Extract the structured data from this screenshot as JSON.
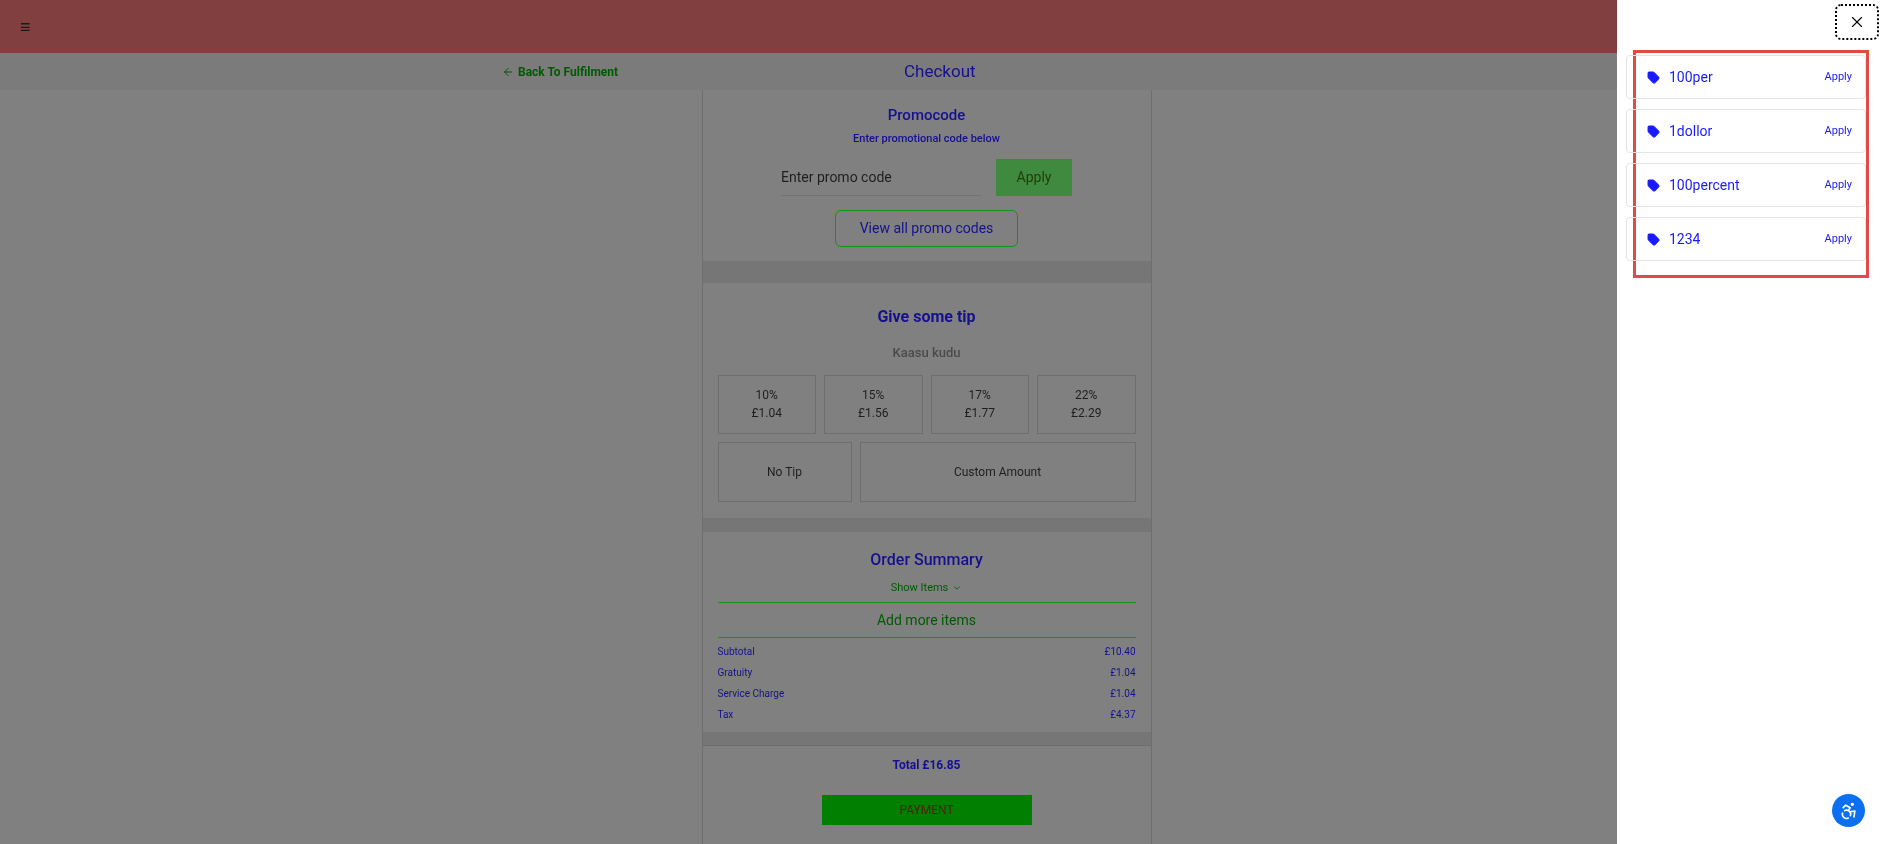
{
  "header": {
    "menu": "≡"
  },
  "subheader": {
    "back_link": "Back To Fulfilment",
    "title": "Checkout"
  },
  "promocode": {
    "title": "Promocode",
    "subtitle": "Enter promotional code below",
    "input": {
      "placeholder": "Enter promo code"
    },
    "apply": "Apply",
    "view_all": "View all promo codes"
  },
  "tip": {
    "title": "Give some tip",
    "subtitle": "Kaasu kudu",
    "options": [
      {
        "percent": "10%",
        "amount": "£1.04",
        "selected": false
      },
      {
        "percent": "15%",
        "amount": "£1.56",
        "selected": false
      },
      {
        "percent": "17%",
        "amount": "£1.77",
        "selected": false
      },
      {
        "percent": "22%",
        "amount": "£2.29",
        "selected": false
      }
    ],
    "others": [
      {
        "label": "No Tip",
        "selected": false
      },
      {
        "label": "Custom Amount",
        "selected": false
      }
    ]
  },
  "order_summary": {
    "title": "Order Summary",
    "show_items": "Show Items",
    "add_more": "Add more items",
    "lines": [
      {
        "label": "Subtotal",
        "value": "£10.40"
      },
      {
        "label": "Gratuity",
        "value": "£1.04"
      },
      {
        "label": "Service Charge",
        "value": "£1.04"
      },
      {
        "label": "Tax",
        "value": "£4.37"
      }
    ],
    "total": "Total £16.85",
    "payment": "PAYMENT"
  },
  "promo_panel": {
    "codes": [
      {
        "code": "100per",
        "action": "Apply"
      },
      {
        "code": "1dollor",
        "action": "Apply"
      },
      {
        "code": "100percent",
        "action": "Apply"
      },
      {
        "code": "1234",
        "action": "Apply"
      }
    ]
  }
}
